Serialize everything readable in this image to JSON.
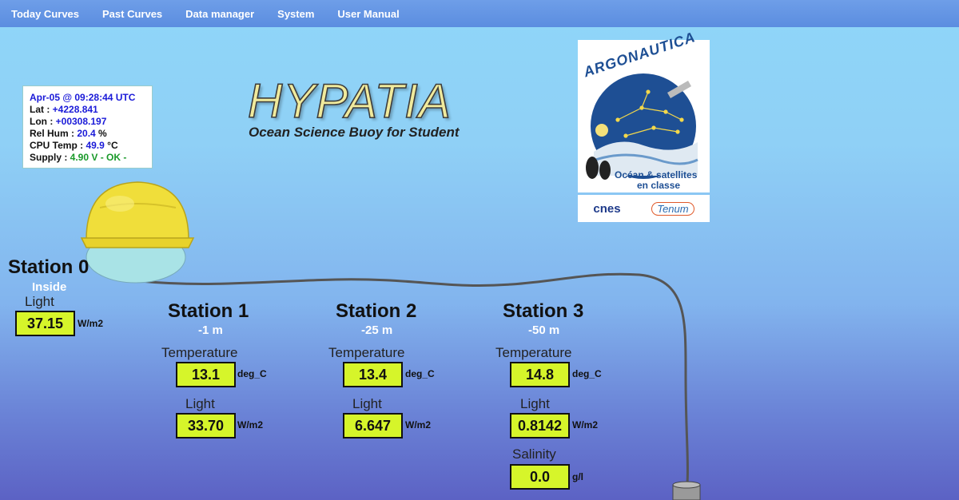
{
  "nav": {
    "items": [
      "Today Curves",
      "Past Curves",
      "Data manager",
      "System",
      "User Manual"
    ]
  },
  "status": {
    "datetime": "Apr-05 @ 09:28:44 UTC",
    "lat_label": "Lat : ",
    "lat_value": "+4228.841",
    "lon_label": "Lon : ",
    "lon_value": "+00308.197",
    "hum_label": "Rel Hum : ",
    "hum_value": "20.4",
    "hum_unit": " %",
    "cpu_label": "CPU Temp : ",
    "cpu_value": "49.9",
    "cpu_unit": " °C",
    "supply_label": "Supply : ",
    "supply_value": "4.90 V - OK -"
  },
  "header": {
    "title": "HYPATIA",
    "subtitle": "Ocean Science Buoy for Student"
  },
  "logos": {
    "argonautica_text": "ARGONAUTICA",
    "tagline_1": "Océan & satellites",
    "tagline_2": "en classe",
    "cnes": "cnes",
    "tenum": "Tenum"
  },
  "stations": {
    "s0": {
      "title": "Station 0",
      "sub": "Inside",
      "light_label": "Light",
      "light_value": "37.15",
      "light_unit": "W/m2"
    },
    "s1": {
      "title": "Station 1",
      "sub": "-1 m",
      "temp_label": "Temperature",
      "temp_value": "13.1",
      "temp_unit": "deg_C",
      "light_label": "Light",
      "light_value": "33.70",
      "light_unit": "W/m2"
    },
    "s2": {
      "title": "Station 2",
      "sub": "-25 m",
      "temp_label": "Temperature",
      "temp_value": "13.4",
      "temp_unit": "deg_C",
      "light_label": "Light",
      "light_value": "6.647",
      "light_unit": "W/m2"
    },
    "s3": {
      "title": "Station 3",
      "sub": "-50 m",
      "temp_label": "Temperature",
      "temp_value": "14.8",
      "temp_unit": "deg_C",
      "light_label": "Light",
      "light_value": "0.8142",
      "light_unit": "W/m2",
      "sal_label": "Salinity",
      "sal_value": "0.0",
      "sal_unit": "g/l"
    }
  },
  "colors": {
    "value_box": "#d6f52a",
    "navbar": "#6294e4",
    "buoy_yellow": "#f0de3a"
  }
}
